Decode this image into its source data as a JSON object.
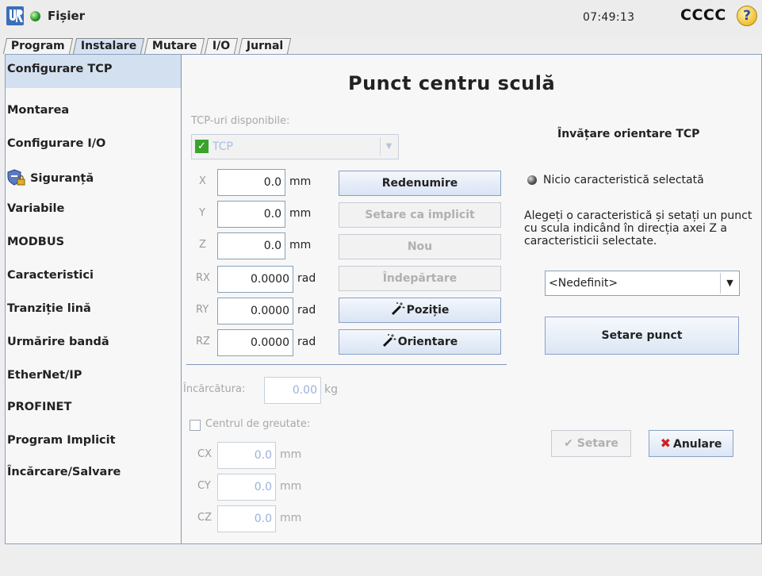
{
  "topbar": {
    "file_menu": "Fișier",
    "clock": "07:49:13",
    "robot_name": "CCCC",
    "help": "?"
  },
  "tabs": [
    {
      "label": "Program"
    },
    {
      "label": "Instalare"
    },
    {
      "label": "Mutare"
    },
    {
      "label": "I/O"
    },
    {
      "label": "Jurnal"
    }
  ],
  "sidebar": {
    "items": [
      {
        "label": "Configurare TCP"
      },
      {
        "label": "Montarea"
      },
      {
        "label": "Configurare I/O"
      },
      {
        "label": "Siguranță"
      },
      {
        "label": "Variabile"
      },
      {
        "label": "MODBUS"
      },
      {
        "label": "Caracteristici"
      },
      {
        "label": "Tranziție lină"
      },
      {
        "label": "Urmărire bandă"
      },
      {
        "label": "EtherNet/IP"
      },
      {
        "label": "PROFINET"
      },
      {
        "label": "Program Implicit"
      },
      {
        "label": "Încărcare/Salvare"
      }
    ]
  },
  "main": {
    "title": "Punct centru sculă",
    "tcp_available_label": "TCP-uri disponibile:",
    "tcp_selected": "TCP",
    "coords": [
      {
        "axis": "X",
        "value": "0.0",
        "unit": "mm"
      },
      {
        "axis": "Y",
        "value": "0.0",
        "unit": "mm"
      },
      {
        "axis": "Z",
        "value": "0.0",
        "unit": "mm"
      },
      {
        "axis": "RX",
        "value": "0.0000",
        "unit": "rad"
      },
      {
        "axis": "RY",
        "value": "0.0000",
        "unit": "rad"
      },
      {
        "axis": "RZ",
        "value": "0.0000",
        "unit": "rad"
      }
    ],
    "buttons": {
      "rename": "Redenumire",
      "set_default": "Setare ca implicit",
      "new": "Nou",
      "remove": "Îndepărtare",
      "position": "Poziție",
      "orientation": "Orientare"
    },
    "payload_label": "Încărcătura:",
    "payload_value": "0.00",
    "payload_unit": "kg",
    "cog_label": "Centrul de greutate:",
    "cog": [
      {
        "axis": "CX",
        "value": "0.0",
        "unit": "mm"
      },
      {
        "axis": "CY",
        "value": "0.0",
        "unit": "mm"
      },
      {
        "axis": "CZ",
        "value": "0.0",
        "unit": "mm"
      }
    ]
  },
  "teach": {
    "title": "Învățare orientare TCP",
    "no_feature": "Nicio caracteristică selectată",
    "instructions": "Alegeți o caracteristică și setați un punct cu scula indicând în direcția axei Z a caracteristicii selectate.",
    "feature_select": "<Nedefinit>",
    "set_point": "Setare punct",
    "set": "Setare",
    "cancel": "Anulare"
  }
}
